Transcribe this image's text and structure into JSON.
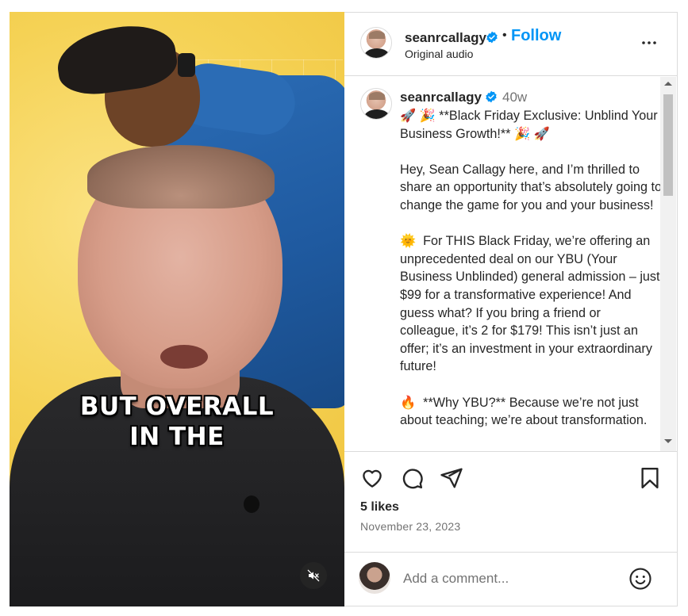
{
  "video": {
    "caption_line1": "BUT OVERALL",
    "caption_line2": "IN THE",
    "mute_icon": "speaker-muted-icon"
  },
  "header": {
    "username": "seanrcallagy",
    "verified": true,
    "separator": "•",
    "follow_label": "Follow",
    "audio_label": "Original audio",
    "more_icon": "more-horizontal-icon"
  },
  "post": {
    "username": "seanrcallagy",
    "time": "40w",
    "caption": "🚀 🎉 **Black Friday Exclusive: Unblind Your Business Growth!** 🎉 🚀\n\nHey, Sean Callagy here, and I’m thrilled to share an opportunity that’s absolutely going to change the game for you and your business!\n\n🌞  For THIS Black Friday, we’re offering an unprecedented deal on our YBU (Your Business Unblinded) general admission – just $99 for a transformative experience! And guess what? If you bring a friend or colleague, it’s 2 for $179! This isn’t just an offer; it’s an investment in your extraordinary future!\n\n🔥  **Why YBU?** Because we’re not just about teaching; we’re about transformation."
  },
  "actions": {
    "like_icon": "heart-icon",
    "comment_icon": "comment-bubble-icon",
    "share_icon": "paper-plane-icon",
    "save_icon": "bookmark-icon",
    "likes": "5 likes",
    "date": "November 23, 2023"
  },
  "comment_box": {
    "placeholder": "Add a comment...",
    "emoji_icon": "smiley-icon"
  },
  "colors": {
    "accent": "#0095f6",
    "verified": "#0095f6",
    "text": "#262626",
    "muted": "#737373",
    "border": "#dbdbdb"
  }
}
